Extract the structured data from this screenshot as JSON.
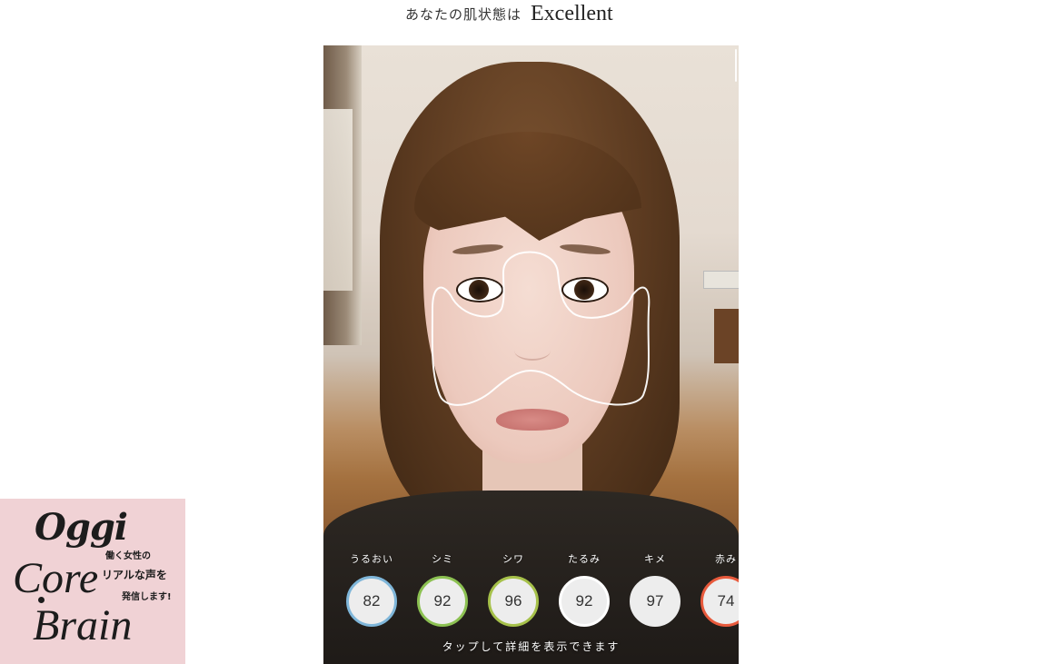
{
  "header": {
    "prefix": "あなたの肌状態は",
    "result": "Excellent"
  },
  "metrics": [
    {
      "label": "うるおい",
      "value": "82",
      "color": "#7fb6d9"
    },
    {
      "label": "シミ",
      "value": "92",
      "color": "#8cc152"
    },
    {
      "label": "シワ",
      "value": "96",
      "color": "#a6c14a"
    },
    {
      "label": "たるみ",
      "value": "92",
      "color": "#ffffff"
    },
    {
      "label": "キメ",
      "value": "97",
      "color": "#ededed"
    },
    {
      "label": "赤み",
      "value": "74",
      "color": "#e85a3c"
    }
  ],
  "tap_hint": "タップして詳細を表示できます",
  "brand": {
    "oggi": "Oggi",
    "core": "Core",
    "brain": "Brain",
    "tagline_1": "働く女性の",
    "tagline_2": "リアルな声を",
    "tagline_3": "発信します!"
  }
}
